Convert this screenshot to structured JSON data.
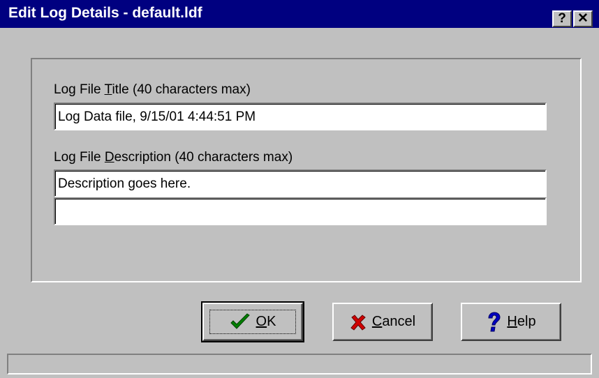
{
  "window": {
    "title": "Edit Log Details - default.ldf",
    "help_button_glyph": "?",
    "close_button_glyph": "✕"
  },
  "form": {
    "title_label_prefix": "Log File ",
    "title_label_mnemonic": "T",
    "title_label_suffix": "itle (40 characters max)",
    "title_value": "Log Data file, 9/15/01 4:44:51 PM",
    "description_label_prefix": "Log File ",
    "description_label_mnemonic": "D",
    "description_label_suffix": "escription (40 characters max)",
    "description_line1_value": "Description goes here.",
    "description_line2_value": ""
  },
  "buttons": {
    "ok_mnemonic": "O",
    "ok_suffix": "K",
    "cancel_mnemonic": "C",
    "cancel_suffix": "ancel",
    "help_mnemonic": "H",
    "help_suffix": "elp"
  },
  "icons": {
    "ok": "checkmark-icon",
    "cancel": "x-icon",
    "help": "question-mark-icon"
  },
  "colors": {
    "titlebar": "#000080",
    "face": "#c0c0c0",
    "check_green": "#008000",
    "x_red": "#d00000",
    "help_blue": "#0000c0"
  }
}
